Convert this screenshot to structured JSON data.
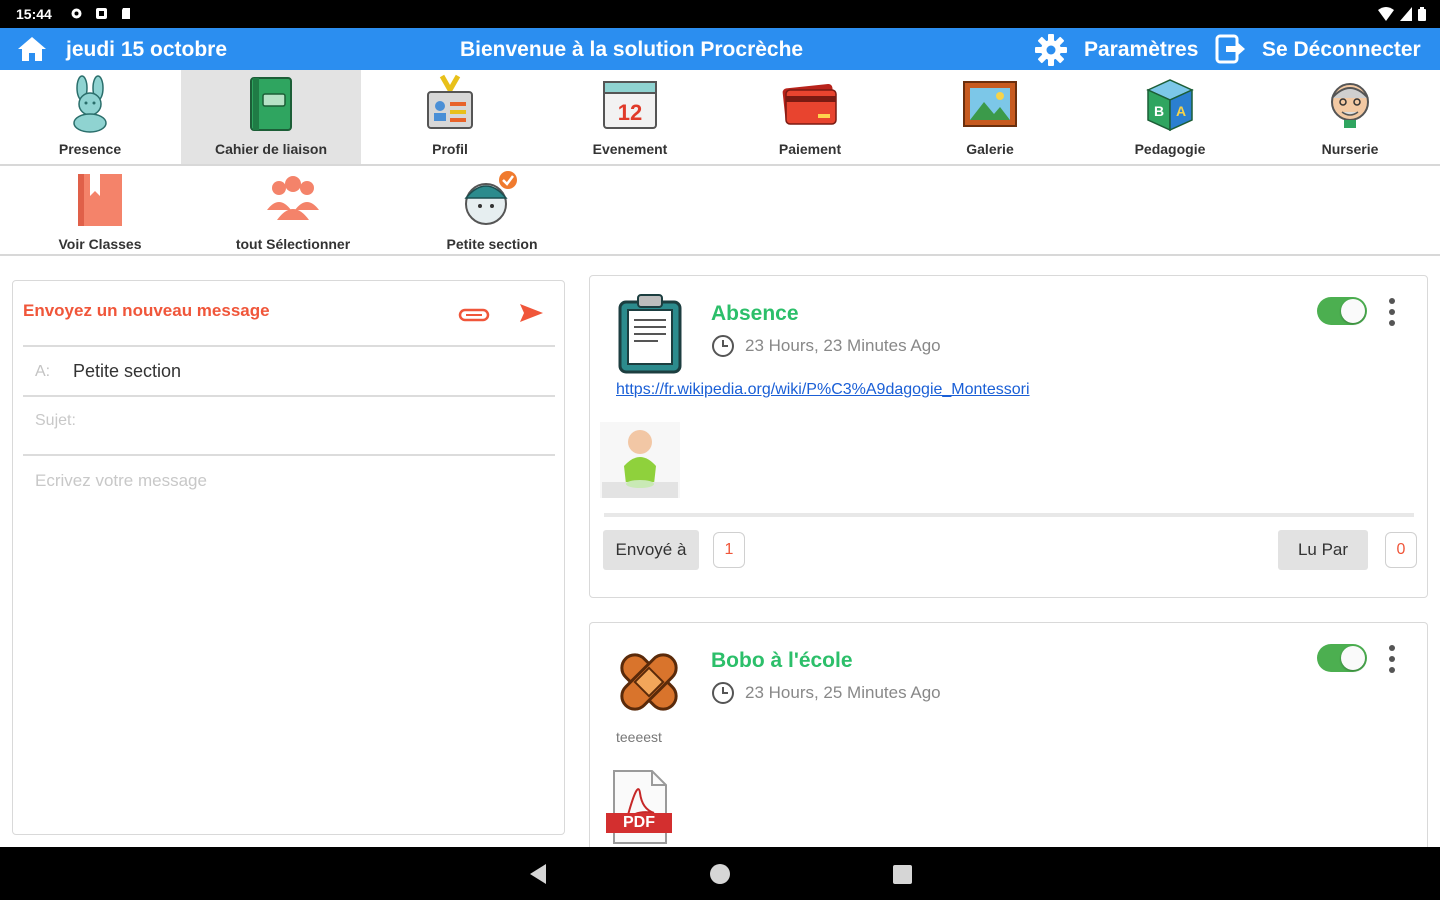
{
  "status_bar": {
    "time": "15:44"
  },
  "header": {
    "date": "jeudi 15 octobre",
    "welcome": "Bienvenue à la solution Procrèche",
    "settings_label": "Paramètres",
    "logout_label": "Se Déconnecter",
    "color": "#2b8ef0"
  },
  "modules": [
    {
      "label": "Presence",
      "icon": "rabbit-icon"
    },
    {
      "label": "Cahier de liaison",
      "icon": "notebook-icon",
      "active": true
    },
    {
      "label": "Profil",
      "icon": "id-badge-icon"
    },
    {
      "label": "Evenement",
      "icon": "calendar-icon"
    },
    {
      "label": "Paiement",
      "icon": "credit-card-icon"
    },
    {
      "label": "Galerie",
      "icon": "picture-frame-icon"
    },
    {
      "label": "Pedagogie",
      "icon": "abc-block-icon"
    },
    {
      "label": "Nurserie",
      "icon": "grandpa-icon"
    }
  ],
  "classes": [
    {
      "label": "Voir Classes",
      "icon": "bookmark-book-icon"
    },
    {
      "label": "tout Sélectionner",
      "icon": "group-icon"
    },
    {
      "label": "Petite section",
      "icon": "baby-selected-icon"
    }
  ],
  "compose": {
    "title": "Envoyez un nouveau message",
    "to_label": "A:",
    "to_value": "Petite section",
    "subject_placeholder": "Sujet:",
    "message_placeholder": "Ecrivez votre message",
    "accent": "#f0563a"
  },
  "messages": [
    {
      "title": "Absence",
      "time_ago": "23 Hours, 23 Minutes Ago",
      "link": "https://fr.wikipedia.org/wiki/P%C3%A9dagogie_Montessori",
      "sent_label": "Envoyé à",
      "sent_count": "1",
      "read_label": "Lu Par",
      "read_count": "0",
      "enabled": true
    },
    {
      "title": "Bobo à l'école",
      "time_ago": "23 Hours, 25 Minutes Ago",
      "author": "teeeest",
      "attachment_label": "PDF",
      "enabled": true
    }
  ]
}
